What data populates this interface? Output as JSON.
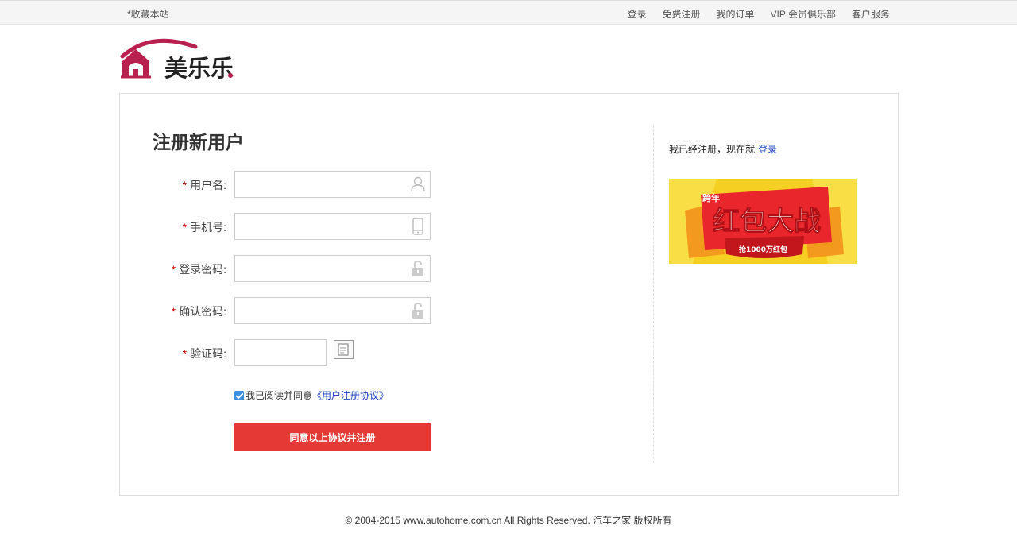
{
  "topbar": {
    "favorite": "*收藏本站",
    "links": [
      "登录",
      "免费注册",
      "我的订单",
      "VIP 会员俱乐部",
      "客户服务"
    ]
  },
  "logo": {
    "text": "美乐乐"
  },
  "form": {
    "title": "注册新用户",
    "required_mark": "*",
    "fields": [
      {
        "label": "用户名:",
        "icon": "user-icon",
        "value": ""
      },
      {
        "label": "手机号:",
        "icon": "phone-icon",
        "value": ""
      },
      {
        "label": "登录密码:",
        "icon": "lock-icon",
        "value": ""
      },
      {
        "label": "确认密码:",
        "icon": "lock-icon",
        "value": ""
      },
      {
        "label": "验证码:",
        "icon": "captcha-icon",
        "value": ""
      }
    ],
    "agree_text": "我已阅读并同意",
    "agree_link": "《用户注册协议》",
    "agree_checked": true,
    "submit": "同意以上协议并注册"
  },
  "side": {
    "already": "我已经注册，现在就",
    "login": "登录",
    "banner": {
      "small": "跨年",
      "main": "红包大战",
      "sub": "抢1000万红包"
    }
  },
  "footer": "© 2004-2015 www.autohome.com.cn All Rights Reserved. 汽车之家 版权所有",
  "colors": {
    "accent": "#e53935",
    "link": "#1a3fc0",
    "checkbox": "#3d8fe0",
    "logo": "#b8214f"
  }
}
